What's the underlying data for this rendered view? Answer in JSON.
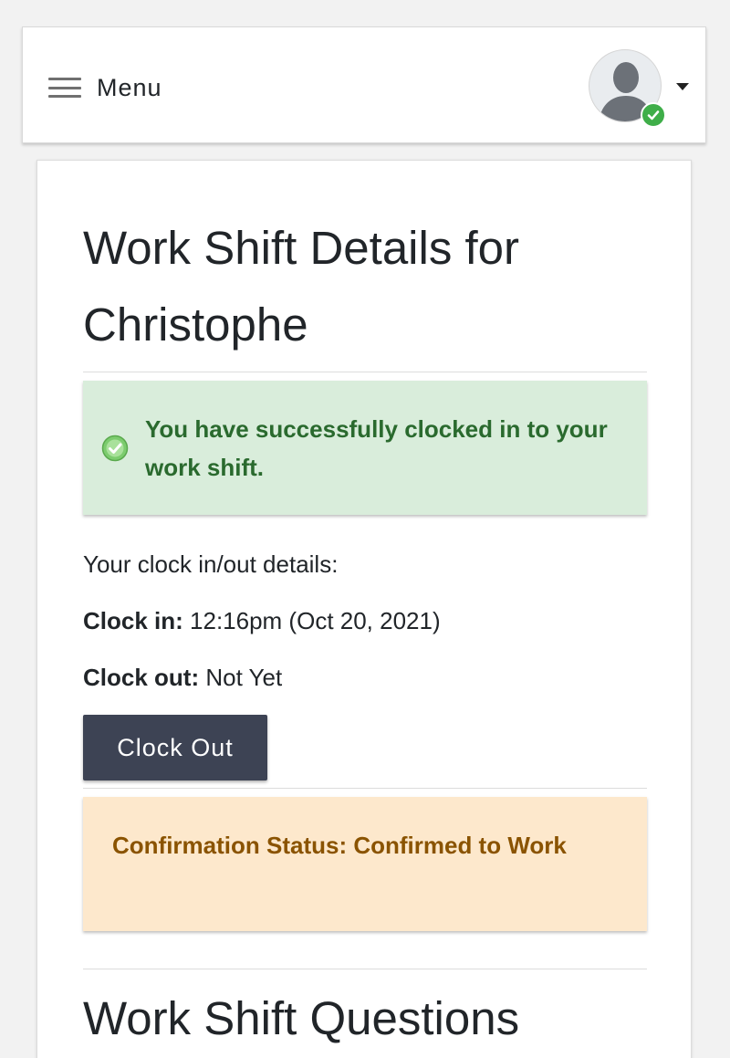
{
  "header": {
    "menu_label": "Menu",
    "icons": {
      "hamburger": "hamburger-icon",
      "avatar": "user-avatar-icon",
      "online": "check-circle-icon",
      "dropdown": "caret-down-icon"
    },
    "status_color": "#3fae49"
  },
  "main": {
    "title": "Work Shift Details for Christophe",
    "success_alert": {
      "icon": "check-circle-icon",
      "message": "You have successfully clocked in to your work shift.",
      "color": "#2a6a2e",
      "background": "#d9eddb"
    },
    "details_intro": "Your clock in/out details:",
    "clock_in": {
      "label": "Clock in:",
      "value": "12:16pm (Oct 20, 2021)"
    },
    "clock_out": {
      "label": "Clock out:",
      "value": "Not Yet"
    },
    "clock_out_button": "Clock Out",
    "button_color": "#3d4354",
    "confirmation_alert": {
      "message": "Confirmation Status: Confirmed to Work",
      "color": "#8a5300",
      "background": "#fde8cc"
    },
    "questions_title": "Work Shift Questions"
  }
}
